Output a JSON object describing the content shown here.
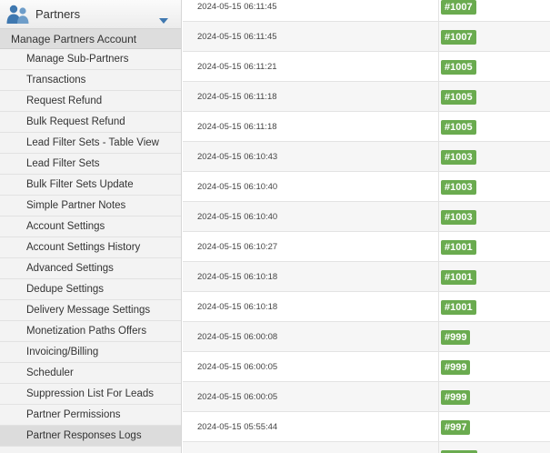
{
  "sidebar": {
    "title": "Partners",
    "section": "Manage Partners Account",
    "items": [
      {
        "label": "Manage Sub-Partners",
        "name": "sidebar-item-manage-sub-partners"
      },
      {
        "label": "Transactions",
        "name": "sidebar-item-transactions"
      },
      {
        "label": "Request Refund",
        "name": "sidebar-item-request-refund"
      },
      {
        "label": "Bulk Request Refund",
        "name": "sidebar-item-bulk-request-refund"
      },
      {
        "label": "Lead Filter Sets - Table View",
        "name": "sidebar-item-lead-filter-sets-table-view"
      },
      {
        "label": "Lead Filter Sets",
        "name": "sidebar-item-lead-filter-sets"
      },
      {
        "label": "Bulk Filter Sets Update",
        "name": "sidebar-item-bulk-filter-sets-update"
      },
      {
        "label": "Simple Partner Notes",
        "name": "sidebar-item-simple-partner-notes"
      },
      {
        "label": "Account Settings",
        "name": "sidebar-item-account-settings"
      },
      {
        "label": "Account Settings History",
        "name": "sidebar-item-account-settings-history"
      },
      {
        "label": "Advanced Settings",
        "name": "sidebar-item-advanced-settings"
      },
      {
        "label": "Dedupe Settings",
        "name": "sidebar-item-dedupe-settings"
      },
      {
        "label": "Delivery Message Settings",
        "name": "sidebar-item-delivery-message-settings"
      },
      {
        "label": "Monetization Paths Offers",
        "name": "sidebar-item-monetization-paths-offers"
      },
      {
        "label": "Invoicing/Billing",
        "name": "sidebar-item-invoicing-billing"
      },
      {
        "label": "Scheduler",
        "name": "sidebar-item-scheduler"
      },
      {
        "label": "Suppression List For Leads",
        "name": "sidebar-item-suppression-list-for-leads"
      },
      {
        "label": "Partner Permissions",
        "name": "sidebar-item-partner-permissions"
      },
      {
        "label": "Partner Responses Logs",
        "name": "sidebar-item-partner-responses-logs",
        "active": true
      }
    ]
  },
  "logs": {
    "rows": [
      {
        "datetime": "2024-05-15 06:11:45",
        "id": "#1007"
      },
      {
        "datetime": "2024-05-15 06:11:45",
        "id": "#1007"
      },
      {
        "datetime": "2024-05-15 06:11:21",
        "id": "#1005"
      },
      {
        "datetime": "2024-05-15 06:11:18",
        "id": "#1005"
      },
      {
        "datetime": "2024-05-15 06:11:18",
        "id": "#1005"
      },
      {
        "datetime": "2024-05-15 06:10:43",
        "id": "#1003"
      },
      {
        "datetime": "2024-05-15 06:10:40",
        "id": "#1003"
      },
      {
        "datetime": "2024-05-15 06:10:40",
        "id": "#1003"
      },
      {
        "datetime": "2024-05-15 06:10:27",
        "id": "#1001"
      },
      {
        "datetime": "2024-05-15 06:10:18",
        "id": "#1001"
      },
      {
        "datetime": "2024-05-15 06:10:18",
        "id": "#1001"
      },
      {
        "datetime": "2024-05-15 06:00:08",
        "id": "#999"
      },
      {
        "datetime": "2024-05-15 06:00:05",
        "id": "#999"
      },
      {
        "datetime": "2024-05-15 06:00:05",
        "id": "#999"
      },
      {
        "datetime": "2024-05-15 05:55:44",
        "id": "#997"
      }
    ]
  },
  "colors": {
    "badge": "#6aab4f",
    "icon": "#3f78b0"
  },
  "icons": {
    "header": "users-icon",
    "toggle": "chevron-down-icon"
  }
}
